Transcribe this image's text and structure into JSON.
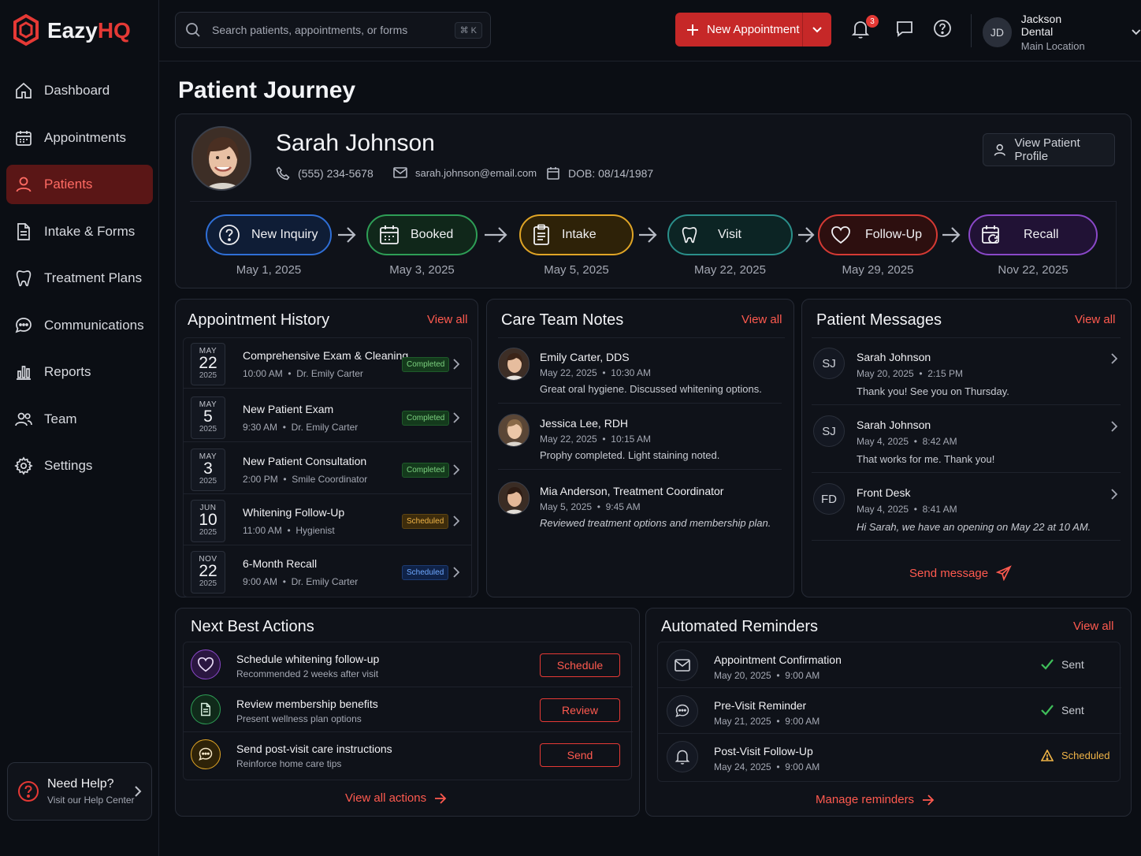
{
  "app": {
    "logo_prefix": "Eazy",
    "logo_suffix": "HQ",
    "accent": "#e53935"
  },
  "sidebar": {
    "items": [
      {
        "label": "Dashboard",
        "icon": "home-icon"
      },
      {
        "label": "Appointments",
        "icon": "calendar-icon"
      },
      {
        "label": "Patients",
        "icon": "user-icon",
        "active": true
      },
      {
        "label": "Intake & Forms",
        "icon": "document-icon"
      },
      {
        "label": "Treatment Plans",
        "icon": "tooth-icon"
      },
      {
        "label": "Communications",
        "icon": "chat-icon"
      },
      {
        "label": "Reports",
        "icon": "bar-chart-icon"
      },
      {
        "label": "Team",
        "icon": "team-icon"
      },
      {
        "label": "Settings",
        "icon": "gear-icon"
      }
    ],
    "help": {
      "title": "Need Help?",
      "subtitle": "Visit our Help Center"
    }
  },
  "topbar": {
    "search_placeholder": "Search patients, appointments, or forms",
    "shortcut": "⌘ K",
    "new_appointment": "New Appointment",
    "notification_count": "3",
    "user_initials": "JD",
    "user_name": "Jackson Dental",
    "user_location": "Main Location"
  },
  "page": {
    "title": "Patient Journey"
  },
  "patient": {
    "name": "Sarah Johnson",
    "phone": "(555) 234-5678",
    "email": "sarah.johnson@email.com",
    "dob": "DOB: 08/14/1987",
    "view_profile": "View Patient Profile"
  },
  "journey": [
    {
      "label": "New Inquiry",
      "date": "May 1, 2025",
      "icon": "question-icon",
      "color": "#2f6fd6"
    },
    {
      "label": "Booked",
      "date": "May 3, 2025",
      "icon": "calendar-icon",
      "color": "#2e9e56"
    },
    {
      "label": "Intake",
      "date": "May 5, 2025",
      "icon": "clipboard-icon",
      "color": "#e0a526"
    },
    {
      "label": "Visit",
      "date": "May 22, 2025",
      "icon": "tooth-icon",
      "color": "#2a8f8a"
    },
    {
      "label": "Follow-Up",
      "date": "May 29, 2025",
      "icon": "heart-icon",
      "color": "#d63a34"
    },
    {
      "label": "Recall",
      "date": "Nov 22, 2025",
      "icon": "calendar-refresh-icon",
      "color": "#8a48c8"
    }
  ],
  "appointment_history": {
    "title": "Appointment History",
    "view_all": "View all",
    "items": [
      {
        "month": "MAY",
        "day": "22",
        "year": "2025",
        "title": "Comprehensive Exam & Cleaning",
        "time": "10:00 AM",
        "provider": "Dr. Emily Carter",
        "status": "Completed"
      },
      {
        "month": "MAY",
        "day": "5",
        "year": "2025",
        "title": "New Patient Exam",
        "time": "9:30 AM",
        "provider": "Dr. Emily Carter",
        "status": "Completed"
      },
      {
        "month": "MAY",
        "day": "3",
        "year": "2025",
        "title": "New Patient Consultation",
        "time": "2:00 PM",
        "provider": "Smile Coordinator",
        "status": "Completed"
      },
      {
        "month": "JUN",
        "day": "10",
        "year": "2025",
        "title": "Whitening Follow-Up",
        "time": "11:00 AM",
        "provider": "Hygienist",
        "status": "Scheduled"
      },
      {
        "month": "NOV",
        "day": "22",
        "year": "2025",
        "title": "6-Month Recall",
        "time": "9:00 AM",
        "provider": "Dr. Emily Carter",
        "status": "Scheduled"
      }
    ]
  },
  "care_notes": {
    "title": "Care Team Notes",
    "view_all": "View all",
    "items": [
      {
        "name": "Emily Carter, DDS",
        "date": "May 22, 2025",
        "time": "10:30 AM",
        "text": "Great oral hygiene. Discussed whitening options."
      },
      {
        "name": "Jessica Lee, RDH",
        "date": "May 22, 2025",
        "time": "10:15 AM",
        "text": "Prophy completed. Light staining noted."
      },
      {
        "name": "Mia Anderson, Treatment Coordinator",
        "date": "May 5, 2025",
        "time": "9:45 AM",
        "text": "Reviewed treatment options and membership plan."
      }
    ]
  },
  "messages": {
    "title": "Patient Messages",
    "view_all": "View all",
    "send": "Send message",
    "items": [
      {
        "initials": "SJ",
        "name": "Sarah Johnson",
        "date": "May 20, 2025",
        "time": "2:15 PM",
        "text": "Thank you! See you on Thursday."
      },
      {
        "initials": "SJ",
        "name": "Sarah Johnson",
        "date": "May 4, 2025",
        "time": "8:42 AM",
        "text": "That works for me. Thank you!"
      },
      {
        "initials": "FD",
        "name": "Front Desk",
        "date": "May 4, 2025",
        "time": "8:41 AM",
        "text": "Hi Sarah, we have an opening on May 22 at 10 AM."
      }
    ]
  },
  "actions": {
    "title": "Next Best Actions",
    "view_all": "View all actions",
    "items": [
      {
        "title": "Schedule whitening follow-up",
        "subtitle": "Recommended 2 weeks after visit",
        "button": "Schedule",
        "icon": "heart-icon",
        "color": "#8a48c8"
      },
      {
        "title": "Review membership benefits",
        "subtitle": "Present wellness plan options",
        "button": "Review",
        "icon": "document-icon",
        "color": "#2e9e56"
      },
      {
        "title": "Send post-visit care instructions",
        "subtitle": "Reinforce home care tips",
        "button": "Send",
        "icon": "chat-icon",
        "color": "#e0a526"
      }
    ]
  },
  "reminders": {
    "title": "Automated Reminders",
    "view_all": "View all",
    "manage": "Manage reminders",
    "items": [
      {
        "title": "Appointment Confirmation",
        "date": "May 20, 2025",
        "time": "9:00 AM",
        "status": "Sent",
        "icon": "mail-icon"
      },
      {
        "title": "Pre-Visit Reminder",
        "date": "May 21, 2025",
        "time": "9:00 AM",
        "status": "Sent",
        "icon": "chat-icon"
      },
      {
        "title": "Post-Visit Follow-Up",
        "date": "May 24, 2025",
        "time": "9:00 AM",
        "status": "Scheduled",
        "icon": "bell-icon"
      }
    ]
  }
}
